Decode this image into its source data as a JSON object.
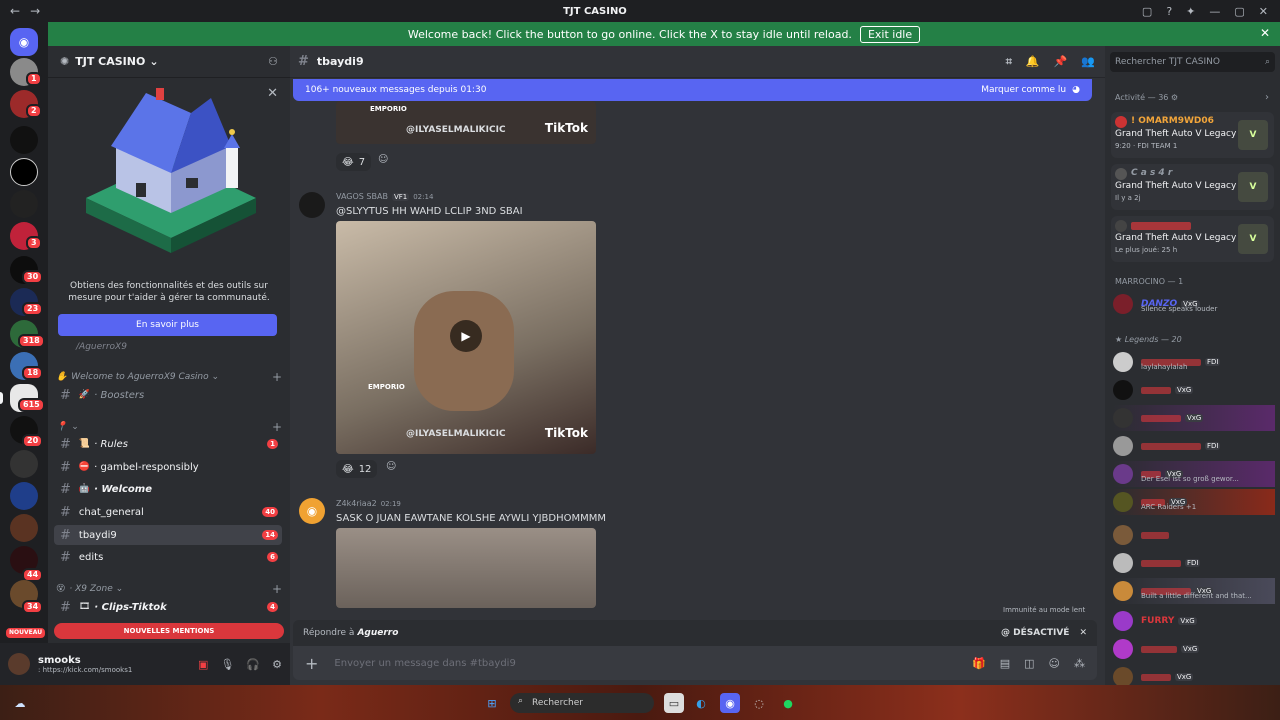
{
  "titlebar": {
    "title": "TJT CASINO",
    "back": "←",
    "forward": "→",
    "controls": [
      "▢",
      "?",
      "✦",
      "—",
      "▢",
      "✕"
    ]
  },
  "banner": {
    "text": "Welcome back! Click the button to go online. Click the X to stay idle until reload.",
    "button": "Exit idle",
    "close": "✕"
  },
  "servers": {
    "badges": [
      "1",
      "2",
      "3",
      "30",
      "23",
      "318",
      "18",
      "615",
      "20",
      "44",
      "34"
    ],
    "nouveau": "NOUVEAU"
  },
  "guild": {
    "name": "TJT CASINO",
    "chevron": "⌄"
  },
  "promo": {
    "close": "✕",
    "text": "Obtiens des fonctionnalités et des outils sur mesure pour t'aider à gérer ta communauté.",
    "cta": "En savoir plus",
    "hidden_channel": "/AguerroX9"
  },
  "categories": [
    {
      "label": "Welcome to AguerroX9 Casino ⌄"
    },
    {
      "label": "⌄"
    },
    {
      "label": "· X9 Zone ⌄"
    }
  ],
  "channels": [
    {
      "name": "· Boosters",
      "count": ""
    },
    {
      "name": "· Rules",
      "count": "1"
    },
    {
      "name": "· gambel-responsibly",
      "count": ""
    },
    {
      "name": "· Welcome",
      "count": ""
    },
    {
      "name": "chat_general",
      "count": "40"
    },
    {
      "name": "tbaydi9",
      "count": "14"
    },
    {
      "name": "edits",
      "count": "6"
    },
    {
      "name": "· Clips-Tiktok",
      "count": "4"
    }
  ],
  "mentions": "NOUVELLES MENTIONS",
  "user": {
    "name": "smooks",
    "status": ": https://kick.com/smooks1"
  },
  "chat": {
    "channel": "tbaydi9",
    "new_messages": "106+ nouveaux messages depuis 01:30",
    "mark_read": "Marquer comme lu",
    "messages": [
      {
        "reaction_count": "7"
      },
      {
        "author": "VAGOS SBAB",
        "tag": "VF1",
        "time": "02:14",
        "text": "@SLYYTUS HH WAHD LCLIP 3ND SBAI",
        "reaction_count": "12"
      },
      {
        "author": "Z4k4riaa2",
        "time": "02:19",
        "text": "SASK O JUAN EAWTANE KOLSHE AYWLI YJBDHOMMMM"
      }
    ],
    "video_watermark": "@ILYASELMALIKICIC",
    "tiktok": "TikTok",
    "emporio": "EMPORIO"
  },
  "immunity": "Immunité au mode lent",
  "reply": {
    "prefix": "Répondre à",
    "name": "Aguerro",
    "mention": "@ DÉSACTIVÉ",
    "close": "✕"
  },
  "composer": {
    "placeholder": "Envoyer un message dans #tbaydi9",
    "plus": "+"
  },
  "members": {
    "search": "Rechercher TJT CASINO",
    "activity": "Activité — 36",
    "activities": [
      {
        "name": "! OMARM9WD06",
        "game": "Grand Theft Auto V Legacy",
        "sub": "9:20 · FDI TEAM 1",
        "color": "#f2a53a"
      },
      {
        "name": "C a s 4 r",
        "game": "Grand Theft Auto V Legacy",
        "sub": "Il y a 2j",
        "color": "#949ba4"
      },
      {
        "name": "",
        "game": "Grand Theft Auto V Legacy",
        "sub": "Le plus joué: 25 h",
        "color": "#da373c"
      }
    ],
    "group1": "MARROCINO — 1",
    "group2": "Legends — 20",
    "list": [
      {
        "name": "DANZO",
        "tag": "VxG",
        "sub": "Silence speaks louder",
        "color": "#5865f2"
      },
      {
        "name": "",
        "tag": "FDI",
        "sub": "laylahaylalah",
        "color": "#da373c"
      },
      {
        "name": "",
        "tag": "VxG",
        "sub": "",
        "color": "#da373c"
      },
      {
        "name": "",
        "tag": "VxG",
        "sub": "",
        "color": "#da373c"
      },
      {
        "name": "",
        "tag": "FDI",
        "sub": "",
        "color": "#da373c"
      },
      {
        "name": "",
        "tag": "VxG",
        "sub": "Der Esel ist so groß gewor...",
        "color": "#da373c"
      },
      {
        "name": "",
        "tag": "VxG",
        "sub": "ARC Raiders +1",
        "color": "#da373c"
      },
      {
        "name": "",
        "tag": "",
        "sub": "",
        "color": "#da373c"
      },
      {
        "name": "",
        "tag": "FDI",
        "sub": "",
        "color": "#da373c"
      },
      {
        "name": "",
        "tag": "VxG",
        "sub": "Built a little different and that...",
        "color": "#da373c"
      },
      {
        "name": "FURRY",
        "tag": "VxG",
        "sub": "",
        "color": "#da373c"
      },
      {
        "name": "",
        "tag": "VxG",
        "sub": "",
        "color": "#da373c"
      },
      {
        "name": "",
        "tag": "VxG",
        "sub": "",
        "color": "#da373c"
      }
    ]
  },
  "taskbar": {
    "search": "Rechercher"
  }
}
